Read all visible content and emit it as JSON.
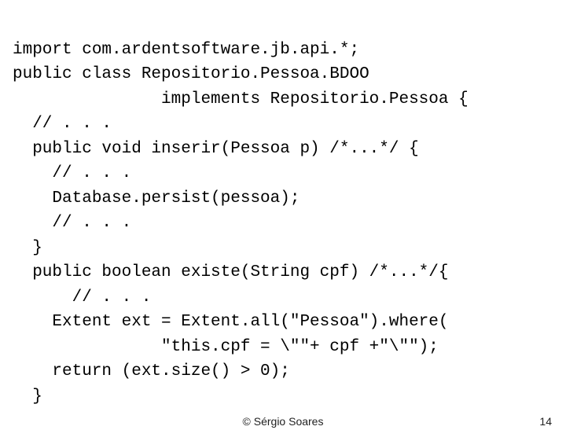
{
  "code": {
    "l1": "import com.ardentsoftware.jb.api.*;",
    "l2": "public class Repositorio.Pessoa.BDOO",
    "l3": "               implements Repositorio.Pessoa {",
    "l4": "  // . . .",
    "l5": "  public void inserir(Pessoa p) /*...*/ {",
    "l6": "    // . . .",
    "l7": "    Database.persist(pessoa);",
    "l8": "    // . . .",
    "l9": "  }",
    "l10": "  public boolean existe(String cpf) /*...*/{",
    "l11": "      // . . .",
    "l12": "    Extent ext = Extent.all(\"Pessoa\").where(",
    "l13": "               \"this.cpf = \\\"\"+ cpf +\"\\\"\");",
    "l14": "    return (ext.size() > 0);",
    "l15": "  }"
  },
  "footer": {
    "copyright": "© Sérgio Soares",
    "page_number": "14"
  }
}
